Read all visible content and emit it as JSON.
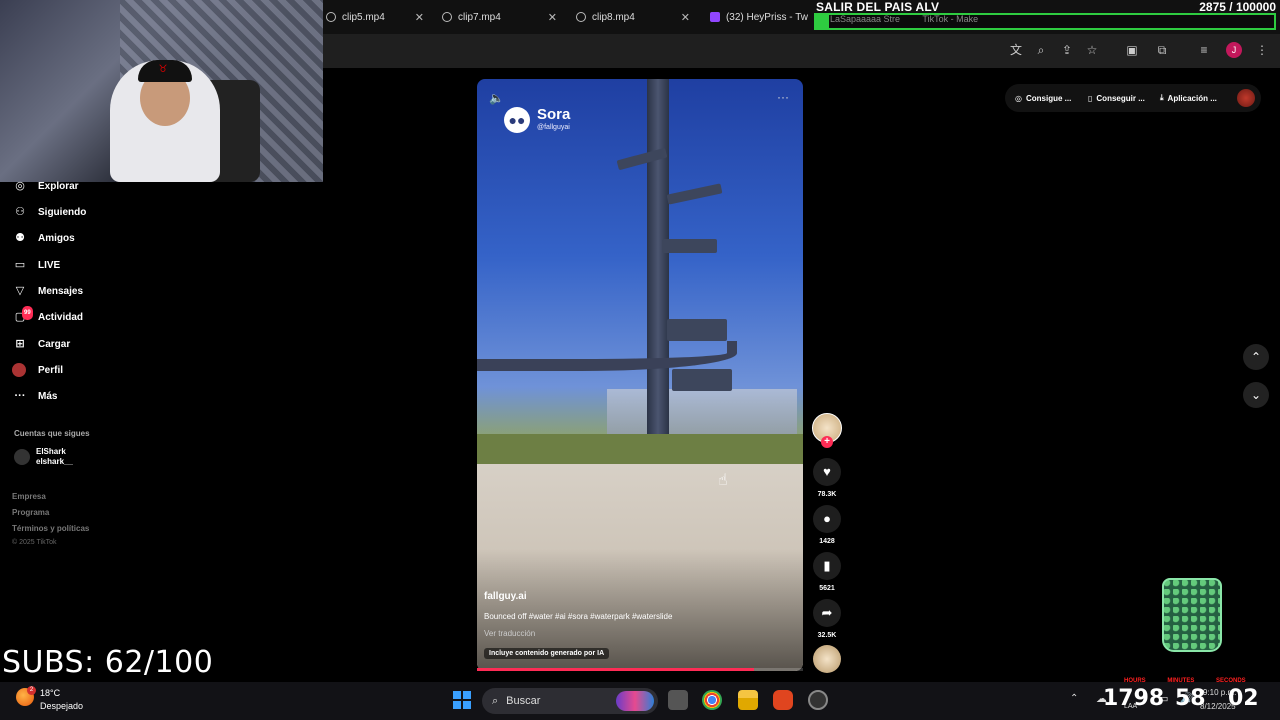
{
  "browser": {
    "tabs": [
      {
        "label": "clip5.mp4"
      },
      {
        "label": "clip7.mp4"
      },
      {
        "label": "clip8.mp4"
      },
      {
        "label": "(32) HeyPriss - Tw"
      }
    ],
    "close_glyph": "✕"
  },
  "overlay": {
    "goal_title": "SALIR DEL PAIS ALV",
    "goal_count": "2875 / 100000",
    "goal_progress_fraction": 0.029,
    "tab_ghost_1": "LaSapaaaaa Stre",
    "tab_ghost_2": "TikTok - Make"
  },
  "sidebar": {
    "items": [
      {
        "label": "Explorar",
        "icon": "compass-icon"
      },
      {
        "label": "Siguiendo",
        "icon": "user-follow-icon"
      },
      {
        "label": "Amigos",
        "icon": "friends-icon"
      },
      {
        "label": "LIVE",
        "icon": "live-icon"
      },
      {
        "label": "Mensajes",
        "icon": "send-icon"
      },
      {
        "label": "Actividad",
        "icon": "inbox-icon",
        "badge": "99"
      },
      {
        "label": "Cargar",
        "icon": "upload-icon"
      },
      {
        "label": "Perfil",
        "icon": "profile-icon"
      },
      {
        "label": "Más",
        "icon": "more-icon"
      }
    ],
    "following_title": "Cuentas que sigues",
    "following": [
      {
        "name": "ElShark",
        "handle": "elshark__"
      }
    ],
    "footer": [
      "Empresa",
      "Programa",
      "Términos y políticas"
    ],
    "copyright": "© 2025 TikTok"
  },
  "subs_counter": "SUBS: 62/100",
  "video": {
    "brand_name": "Sora",
    "brand_handle": "@fallguyai",
    "author": "fallguy.ai",
    "caption": "Bounced off #water #ai #sora #waterpark #waterslide",
    "translate": "Ver traducción",
    "ai_label": "Incluye contenido generado por IA",
    "progress_fraction": 0.85
  },
  "actions": {
    "likes": "78.3K",
    "comments": "1428",
    "saves": "5621",
    "shares": "32.5K"
  },
  "top_pills": [
    {
      "label": "Consigue ..."
    },
    {
      "label": "Conseguir ..."
    },
    {
      "label": "Aplicación ..."
    }
  ],
  "timer": {
    "labels": [
      "HOURS",
      "MINUTES",
      "SECONDS"
    ],
    "hours": "1798",
    "minutes": "58",
    "seconds": "02"
  },
  "taskbar": {
    "temp": "18°C",
    "weather": "Despejado",
    "weather_badge": "2",
    "search_label": "Buscar",
    "clock_time": "9:10 p.m.",
    "clock_date": "8/12/2025",
    "lang": "LAA"
  },
  "colors": {
    "accent_pink": "#fe2c55",
    "goal_green": "#2ecc40"
  }
}
